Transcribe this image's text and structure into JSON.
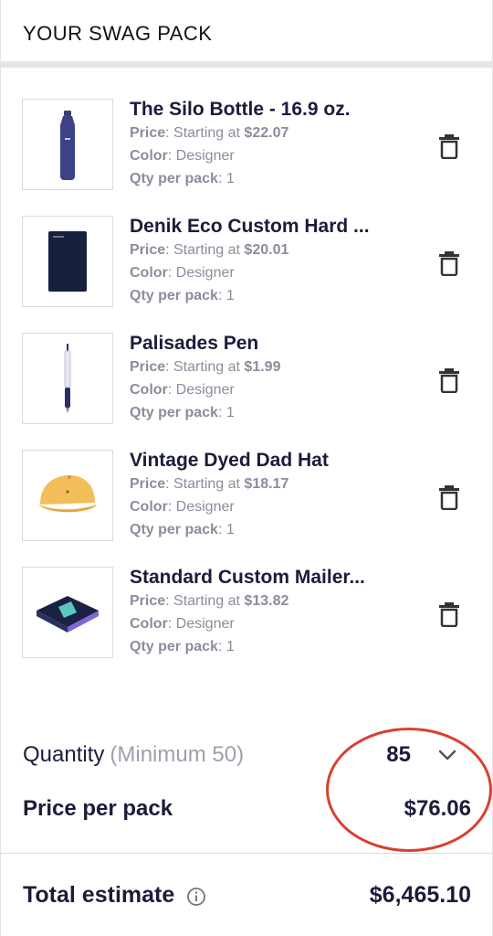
{
  "header": {
    "title": "YOUR SWAG PACK"
  },
  "labels": {
    "price": "Price",
    "color": "Color",
    "qty": "Qty per pack",
    "starting_at": "Starting at"
  },
  "items": [
    {
      "name": "The Silo Bottle - 16.9 oz.",
      "price": "$22.07",
      "color": "Designer",
      "qty": "1",
      "image": "silo-bottle"
    },
    {
      "name": "Denik Eco Custom Hard ...",
      "price": "$20.01",
      "color": "Designer",
      "qty": "1",
      "image": "notebook"
    },
    {
      "name": "Palisades Pen",
      "price": "$1.99",
      "color": "Designer",
      "qty": "1",
      "image": "pen"
    },
    {
      "name": "Vintage Dyed Dad Hat",
      "price": "$18.17",
      "color": "Designer",
      "qty": "1",
      "image": "dad-hat"
    },
    {
      "name": "Standard Custom Mailer...",
      "price": "$13.82",
      "color": "Designer",
      "qty": "1",
      "image": "mailer-box"
    }
  ],
  "quantity": {
    "label": "Quantity",
    "minimum": "(Minimum 50)",
    "value": "85"
  },
  "price_per_pack": {
    "label": "Price per pack",
    "value": "$76.06"
  },
  "total": {
    "label": "Total estimate",
    "value": "$6,465.10"
  },
  "colors": {
    "text": "#1a1d3a",
    "muted": "#8b8d9d",
    "annotation": "#d9402f"
  }
}
